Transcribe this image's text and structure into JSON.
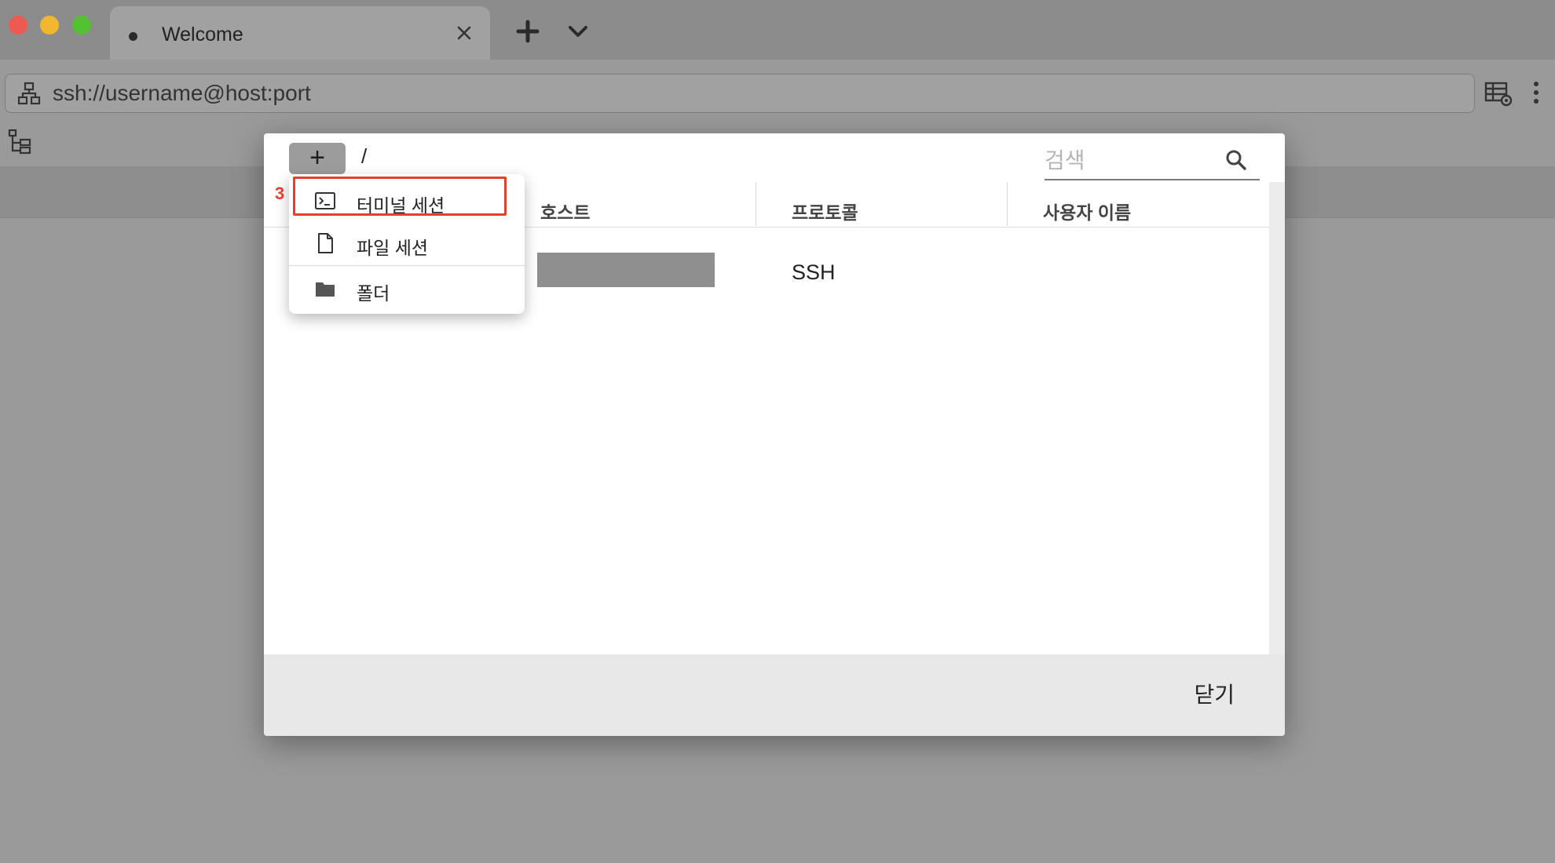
{
  "window": {
    "tab_title": "Welcome"
  },
  "address_bar": {
    "placeholder": "ssh://username@host:port"
  },
  "dialog": {
    "add_button_label": "+",
    "path": "/",
    "search_placeholder": "검색",
    "columns": {
      "host": "호스트",
      "protocol": "프로토콜",
      "username": "사용자 이름"
    },
    "rows": [
      {
        "host": "",
        "protocol": "SSH",
        "username": ""
      }
    ],
    "close_label": "닫기"
  },
  "menu": {
    "items": [
      {
        "label": "터미널 세션",
        "icon": "terminal-icon"
      },
      {
        "label": "파일 세션",
        "icon": "file-icon"
      },
      {
        "label": "폴더",
        "icon": "folder-icon"
      }
    ]
  },
  "annotation": {
    "step": "3",
    "color": "#e3402c"
  }
}
